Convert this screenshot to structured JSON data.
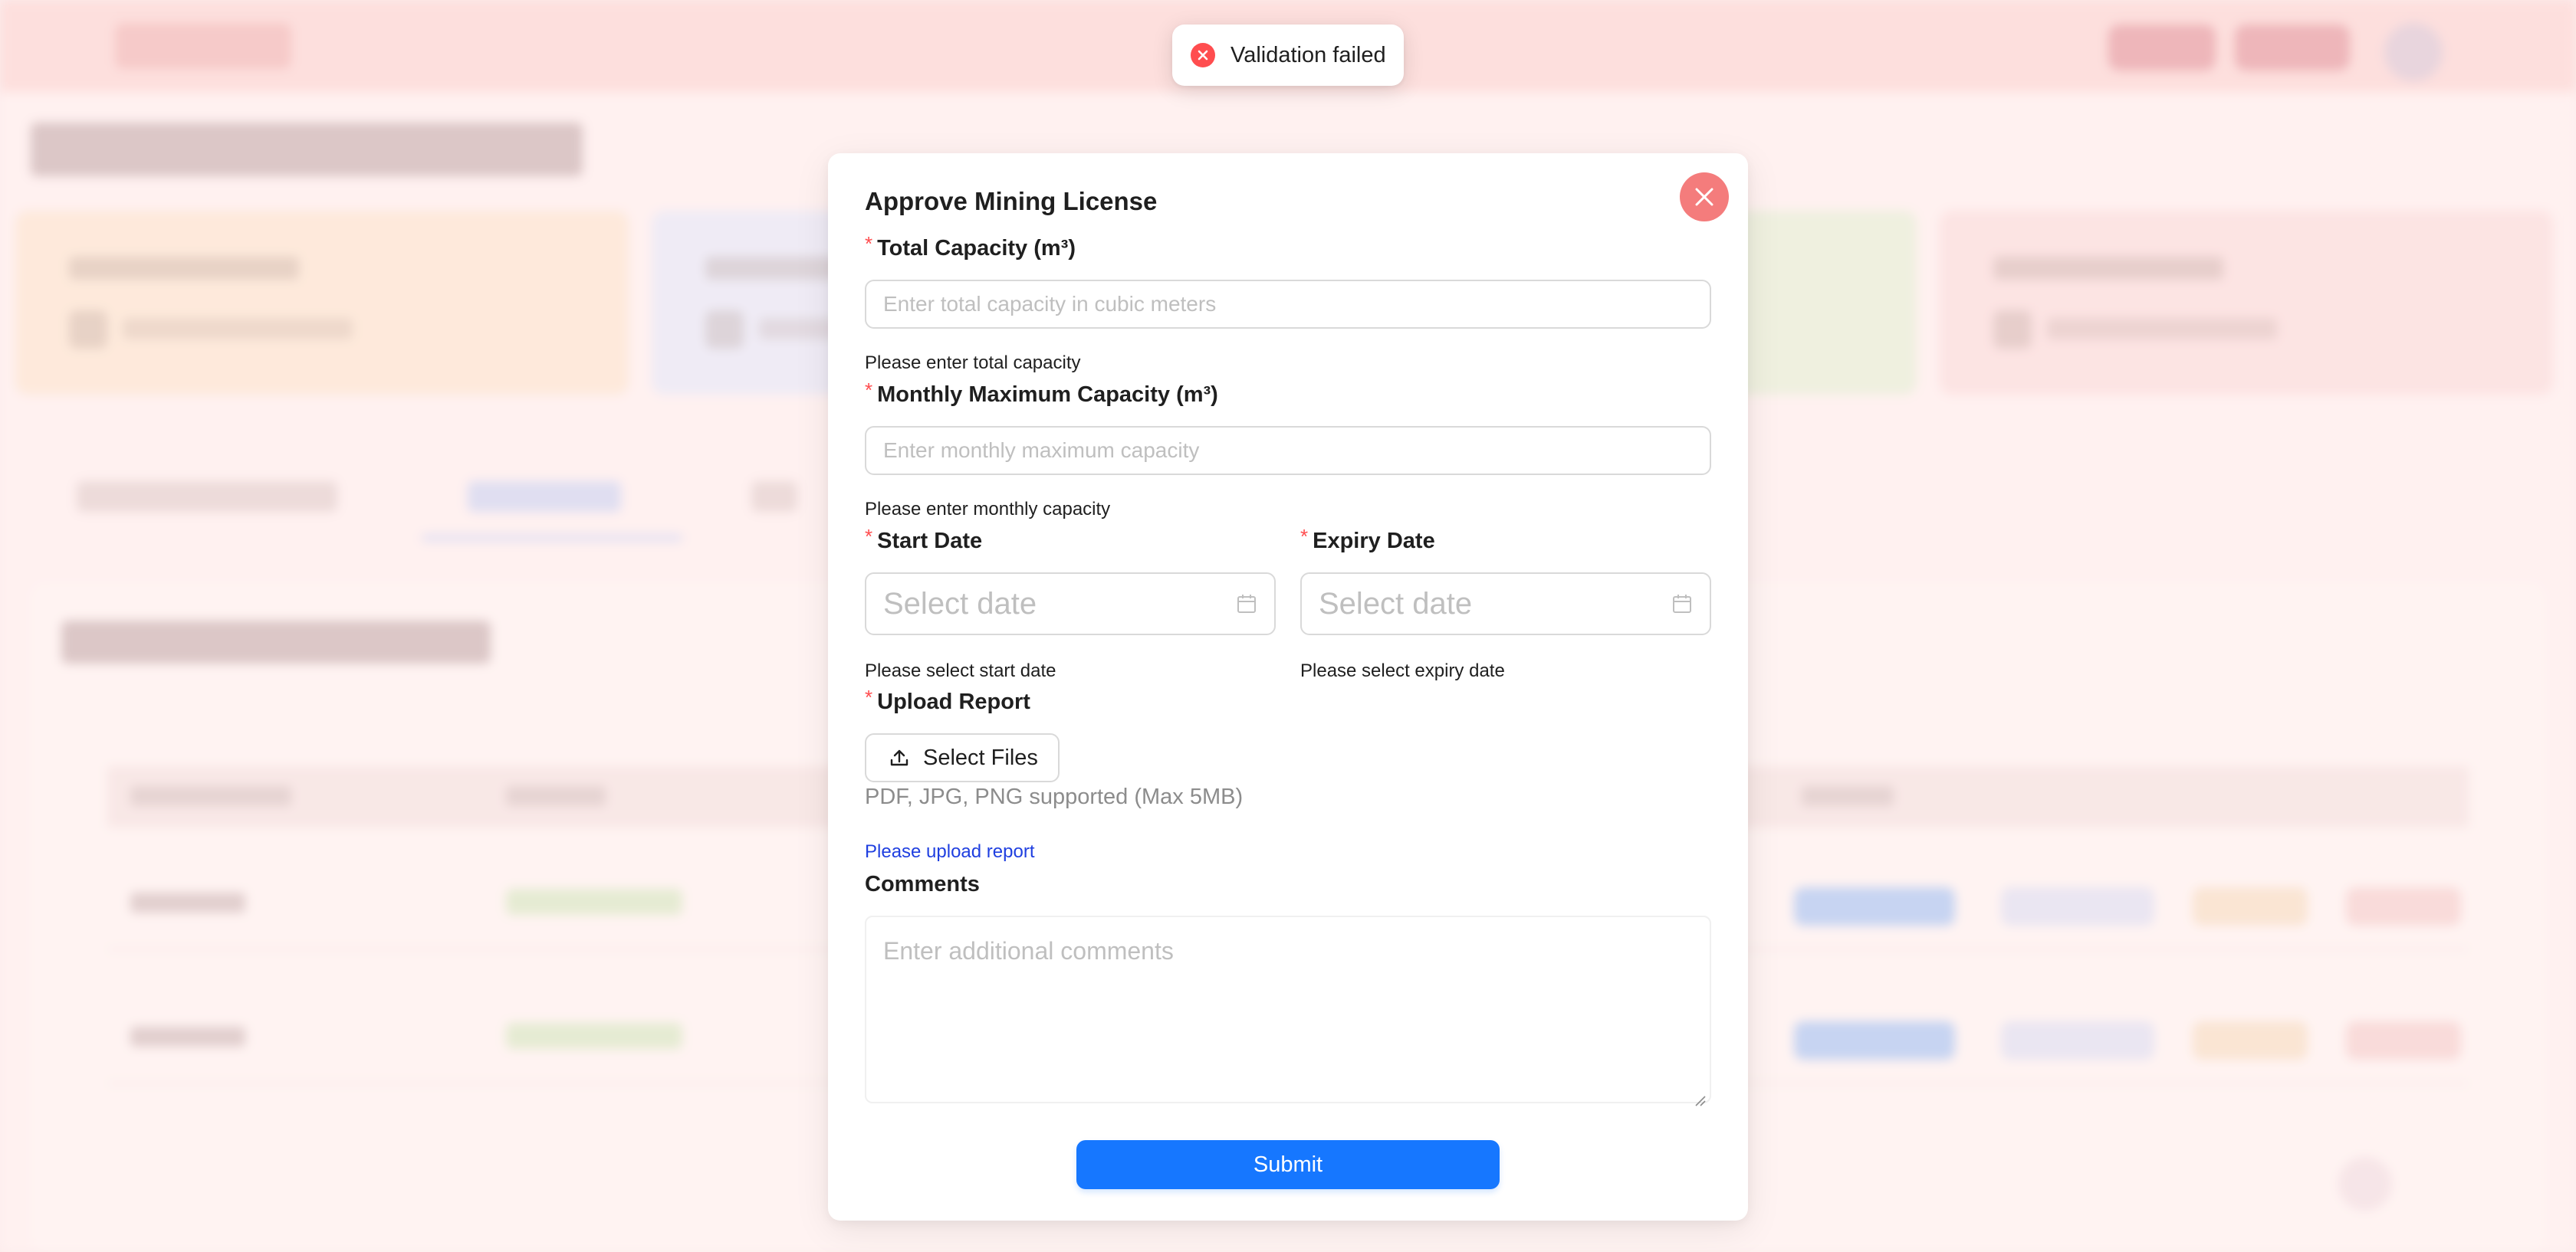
{
  "toast": {
    "message": "Validation failed",
    "icon": "error-circle-icon",
    "color": "#ff4d4f"
  },
  "modal": {
    "title": "Approve Mining License",
    "close_icon": "close-icon",
    "required_mark": "*",
    "fields": {
      "total_capacity": {
        "label": "Total Capacity (m³)",
        "placeholder": "Enter total capacity in cubic meters",
        "error": "Please enter total capacity"
      },
      "monthly_capacity": {
        "label": "Monthly Maximum Capacity (m³)",
        "placeholder": "Enter monthly maximum capacity",
        "error": "Please enter monthly capacity"
      },
      "start_date": {
        "label": "Start Date",
        "placeholder": "Select date",
        "error": "Please select start date"
      },
      "expiry_date": {
        "label": "Expiry Date",
        "placeholder": "Select date",
        "error": "Please select expiry date"
      },
      "upload_report": {
        "label": "Upload Report",
        "button": "Select Files",
        "hint": "PDF, JPG, PNG supported (Max 5MB)",
        "error": "Please upload report"
      },
      "comments": {
        "label": "Comments",
        "placeholder": "Enter additional comments"
      }
    },
    "submit_label": "Submit"
  },
  "colors": {
    "primary": "#1677ff",
    "error": "#ff4d4f",
    "close_button": "#f47c7c",
    "help_link": "#1f3fe0"
  }
}
